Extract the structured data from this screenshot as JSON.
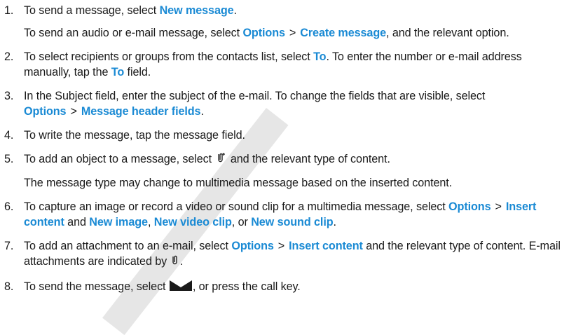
{
  "steps": [
    {
      "num": "1.",
      "paras": [
        [
          {
            "t": "To send a message, select "
          },
          {
            "t": "New message",
            "term": true
          },
          {
            "t": "."
          }
        ],
        [
          {
            "t": "To send an audio or e-mail message, select "
          },
          {
            "t": "Options",
            "term": true
          },
          {
            "t": ">",
            "sep": true
          },
          {
            "t": "Create message",
            "term": true
          },
          {
            "t": ", and the relevant option."
          }
        ]
      ]
    },
    {
      "num": "2.",
      "paras": [
        [
          {
            "t": "To select recipients or groups from the contacts list, select "
          },
          {
            "t": "To",
            "term": true
          },
          {
            "t": ". To enter the number or e-mail address manually, tap the "
          },
          {
            "t": "To",
            "term": true
          },
          {
            "t": " field."
          }
        ]
      ]
    },
    {
      "num": "3.",
      "paras": [
        [
          {
            "t": "In the Subject field, enter the subject of the e-mail. To change the fields that are visible, select "
          },
          {
            "t": "Options",
            "term": true
          },
          {
            "t": ">",
            "sep": true
          },
          {
            "t": "Message header fields",
            "term": true
          },
          {
            "t": "."
          }
        ]
      ]
    },
    {
      "num": "4.",
      "paras": [
        [
          {
            "t": "To write the message, tap the message field."
          }
        ]
      ]
    },
    {
      "num": "5.",
      "paras": [
        [
          {
            "t": "To add an object to a message, select "
          },
          {
            "icon": "attach-plus-icon"
          },
          {
            "t": " and the relevant type of content."
          }
        ],
        [
          {
            "t": "The message type may change to multimedia message based on the inserted content."
          }
        ]
      ]
    },
    {
      "num": "6.",
      "paras": [
        [
          {
            "t": "To capture an image or record a video or sound clip for a multimedia message, select "
          },
          {
            "t": "Options",
            "term": true
          },
          {
            "t": ">",
            "sep": true
          },
          {
            "t": "Insert content",
            "term": true
          },
          {
            "t": " and "
          },
          {
            "t": "New image",
            "term": true
          },
          {
            "t": ", "
          },
          {
            "t": "New video clip",
            "term": true
          },
          {
            "t": ", or "
          },
          {
            "t": "New sound clip",
            "term": true
          },
          {
            "t": "."
          }
        ]
      ]
    },
    {
      "num": "7.",
      "paras": [
        [
          {
            "t": "To add an attachment to an e-mail, select "
          },
          {
            "t": "Options",
            "term": true
          },
          {
            "t": ">",
            "sep": true
          },
          {
            "t": "Insert content",
            "term": true
          },
          {
            "t": " and the relevant type of content. E-mail attachments are indicated by "
          },
          {
            "icon": "attachment-icon"
          },
          {
            "t": "."
          }
        ]
      ]
    },
    {
      "num": "8.",
      "paras": [
        [
          {
            "t": "To send the message, select "
          },
          {
            "icon": "envelope-icon"
          },
          {
            "t": ", or press the call key."
          }
        ]
      ]
    }
  ],
  "colors": {
    "term": "#1a8ad4",
    "text": "#1a1a1a",
    "watermark": "#dedede"
  }
}
